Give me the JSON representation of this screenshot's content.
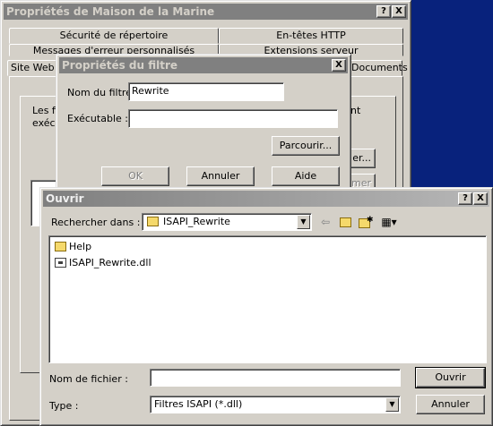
{
  "props_window": {
    "title": "Propriétés de Maison de la Marine",
    "help_btn": "?",
    "close_btn": "X",
    "tabs_row1": [
      "Sécurité de répertoire",
      "En-têtes HTTP"
    ],
    "tabs_row2": [
      "Messages d'erreur personnalisés",
      "Extensions serveur"
    ],
    "tabs_row3": [
      "Site Web",
      "Documents"
    ],
    "partial_text_1": "Les fi",
    "partial_text_2": "exécu",
    "partial_text_3": "nt",
    "partial_button_1": "er...",
    "partial_button_2": "mer"
  },
  "filter_dialog": {
    "title": "Propriétés du filtre",
    "close_btn": "X",
    "name_label": "Nom du filtre :",
    "name_value": "Rewrite",
    "exec_label": "Exécutable :",
    "exec_value": "",
    "browse_button": "Parcourir...",
    "ok_button": "OK",
    "cancel_button": "Annuler",
    "help_button": "Aide"
  },
  "open_dialog": {
    "title": "Ouvrir",
    "help_btn": "?",
    "close_btn": "X",
    "look_in_label": "Rechercher dans :",
    "look_in_value": "ISAPI_Rewrite",
    "files": [
      {
        "name": "Help",
        "type": "folder"
      },
      {
        "name": "ISAPI_Rewrite.dll",
        "type": "dll"
      }
    ],
    "filename_label": "Nom de fichier :",
    "filename_value": "",
    "type_label": "Type :",
    "type_value": "Filtres ISAPI (*.dll)",
    "open_button": "Ouvrir",
    "cancel_button": "Annuler"
  }
}
